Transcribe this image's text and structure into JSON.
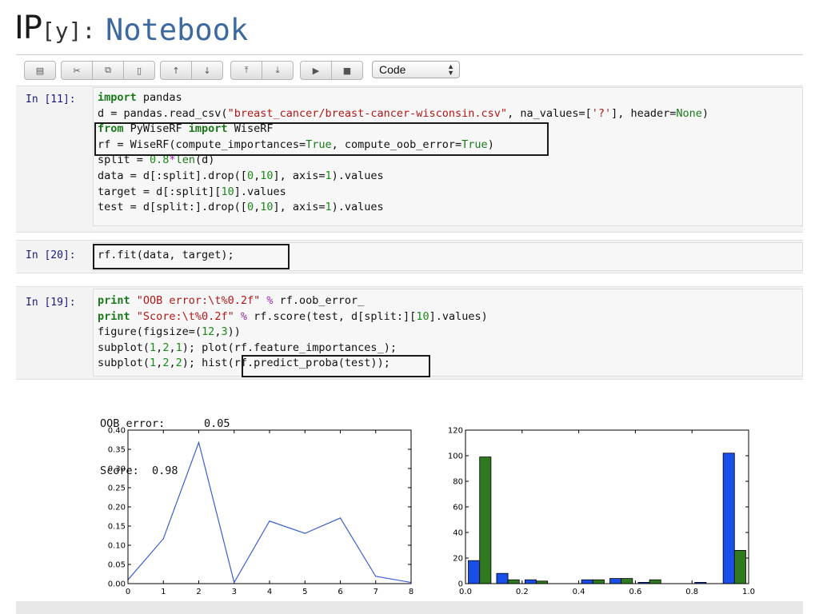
{
  "header": {
    "logo_ip": "IP",
    "logo_y": "[y]:",
    "notebook_title": "Notebook"
  },
  "toolbar": {
    "groups": [
      [
        "save-icon"
      ],
      [
        "cut-icon",
        "copy-icon",
        "paste-icon"
      ],
      [
        "move-up-icon",
        "move-down-icon"
      ],
      [
        "insert-above-icon",
        "insert-below-icon"
      ],
      [
        "run-icon",
        "stop-icon"
      ]
    ],
    "glyphs": {
      "save-icon": "▤",
      "cut-icon": "✂",
      "copy-icon": "⧉",
      "paste-icon": "▯",
      "move-up-icon": "↑",
      "move-down-icon": "↓",
      "insert-above-icon": "⤒",
      "insert-below-icon": "⤓",
      "run-icon": "▶",
      "stop-icon": "■"
    },
    "cell_type": "Code"
  },
  "cells": [
    {
      "prompt": "In [11]:",
      "lines": [
        "import pandas",
        "d = pandas.read_csv(\"breast_cancer/breast-cancer-wisconsin.csv\", na_values=['?'], header=None)",
        "from PyWiseRF import WiseRF",
        "rf = WiseRF(compute_importances=True, compute_oob_error=True)",
        "split = 0.8*len(d)",
        "data = d[:split].drop([0,10], axis=1).values",
        "target = d[:split][10].values",
        "test = d[split:].drop([0,10], axis=1).values"
      ]
    },
    {
      "prompt": "In [20]:",
      "lines": [
        "rf.fit(data, target);"
      ]
    },
    {
      "prompt": "In [19]:",
      "lines": [
        "print \"OOB error:\\t%0.2f\" % rf.oob_error_",
        "print \"Score:\\t%0.2f\" % rf.score(test, d[split:][10].values)",
        "figure(figsize=(12,3))",
        "subplot(1,2,1); plot(rf.feature_importances_);",
        "subplot(1,2,2); hist(rf.predict_proba(test));"
      ]
    }
  ],
  "output": {
    "lines": [
      "OOB error:      0.05",
      "Score:  0.98"
    ]
  },
  "chart_data": [
    {
      "type": "line",
      "x": [
        0,
        1,
        2,
        3,
        4,
        5,
        6,
        7,
        8
      ],
      "series": [
        {
          "values": [
            0.01,
            0.117,
            0.368,
            0.003,
            0.163,
            0.131,
            0.171,
            0.019,
            0.003
          ],
          "color": "#3c5fcf"
        }
      ],
      "xlim": [
        0,
        8
      ],
      "ylim": [
        0,
        0.4
      ],
      "xticks": [
        "0",
        "1",
        "2",
        "3",
        "4",
        "5",
        "6",
        "7",
        "8"
      ],
      "yticks": [
        "0.00",
        "0.05",
        "0.10",
        "0.15",
        "0.20",
        "0.25",
        "0.30",
        "0.35",
        "0.40"
      ],
      "grid": false
    },
    {
      "type": "bar",
      "bins": [
        0.0,
        0.1,
        0.2,
        0.3,
        0.4,
        0.5,
        0.6,
        0.7,
        0.8,
        0.9
      ],
      "bin_width": 0.1,
      "series": [
        {
          "values": [
            18,
            8,
            3,
            0,
            3,
            4,
            1,
            0,
            1,
            102
          ],
          "color": "#1a4ee8"
        },
        {
          "values": [
            99,
            3,
            2,
            0,
            3,
            4,
            3,
            0,
            0,
            26
          ],
          "color": "#2f7a1f"
        }
      ],
      "xlim": [
        0,
        1.0
      ],
      "ylim": [
        0,
        120
      ],
      "xticks": [
        "0.0",
        "0.2",
        "0.4",
        "0.6",
        "0.8",
        "1.0"
      ],
      "yticks": [
        "0",
        "20",
        "40",
        "60",
        "80",
        "100",
        "120"
      ],
      "grid": false
    }
  ]
}
